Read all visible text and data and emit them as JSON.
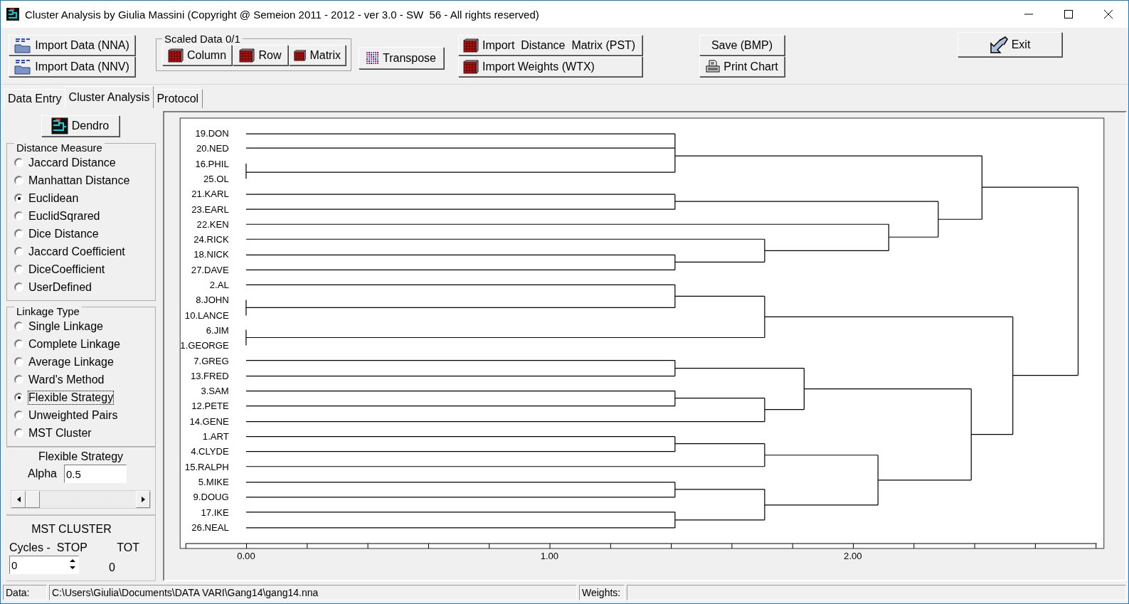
{
  "window": {
    "title": "Cluster Analysis by Giulia Massini (Copyright @ Semeion 2011 - 2012 - ver 3.0 - SW  56 - All rights reserved)"
  },
  "toolbar": {
    "import_buttons": [
      "Import Data (NNA)",
      "Import Data (NNV)"
    ],
    "scaled_group": {
      "title": "Scaled Data 0/1",
      "buttons": [
        "Column",
        "Row",
        "Matrix"
      ]
    },
    "transpose": "Transpose",
    "matrix_buttons": [
      "Import  Distance  Matrix (PST)",
      "Import Weights (WTX)"
    ],
    "save": "Save (BMP)",
    "print": "Print Chart",
    "exit": "Exit"
  },
  "tabs": [
    {
      "label": "Data Entry",
      "selected": false
    },
    {
      "label": "Cluster Analysis",
      "selected": true
    },
    {
      "label": "Protocol",
      "selected": false
    }
  ],
  "left_panel": {
    "dendro_button": "Dendro",
    "distance_measure": {
      "title": "Distance Measure",
      "options": [
        {
          "label": "Jaccard Distance",
          "selected": false
        },
        {
          "label": "Manhattan Distance",
          "selected": false
        },
        {
          "label": "Euclidean",
          "selected": true
        },
        {
          "label": "EuclidSqrared",
          "selected": false
        },
        {
          "label": "Dice Distance",
          "selected": false
        },
        {
          "label": "Jaccard Coefficient",
          "selected": false
        },
        {
          "label": "DiceCoefficient",
          "selected": false
        },
        {
          "label": "UserDefined",
          "selected": false
        }
      ]
    },
    "linkage_type": {
      "title": "Linkage Type",
      "options": [
        {
          "label": "Single Linkage",
          "selected": false
        },
        {
          "label": "Complete Linkage",
          "selected": false
        },
        {
          "label": "Average Linkage",
          "selected": false
        },
        {
          "label": "Ward's Method",
          "selected": false
        },
        {
          "label": "Flexible Strategy",
          "selected": true
        },
        {
          "label": "Unweighted Pairs",
          "selected": false
        },
        {
          "label": "MST Cluster",
          "selected": false
        }
      ]
    },
    "flexible_strategy": {
      "title": "Flexible Strategy",
      "alpha_label": "Alpha",
      "alpha_value": "0.5",
      "slider": {
        "level": 0
      }
    },
    "mst_cluster": {
      "title": "MST CLUSTER",
      "cycles_label": "Cycles -  STOP",
      "tot_label": "TOT",
      "stop_value": "0",
      "tot_value": "0"
    }
  },
  "dendrogram": {
    "leaves": [
      "19.DON",
      "20.NED",
      "16.PHIL",
      "25.OL",
      "21.KARL",
      "23.EARL",
      "22.KEN",
      "24.RICK",
      "18.NICK",
      "27.DAVE",
      "2.AL",
      "8.JOHN",
      "10.LANCE",
      "6.JIM",
      "1.GEORGE",
      "7.GREG",
      "13.FRED",
      "3.SAM",
      "12.PETE",
      "14.GENE",
      "1.ART",
      "4.CLYDE",
      "15.RALPH",
      "5.MIKE",
      "9.DOUG",
      "17.IKE",
      "26.NEAL"
    ],
    "axis_labels": [
      "0.00",
      "1.00",
      "2.00"
    ]
  },
  "status_bar": {
    "data_label": "Data:",
    "data_path": "C:\\Users\\Giulia\\Documents\\DATA VARI\\Gang14\\gang14.nna",
    "weights_label": "Weights:"
  }
}
